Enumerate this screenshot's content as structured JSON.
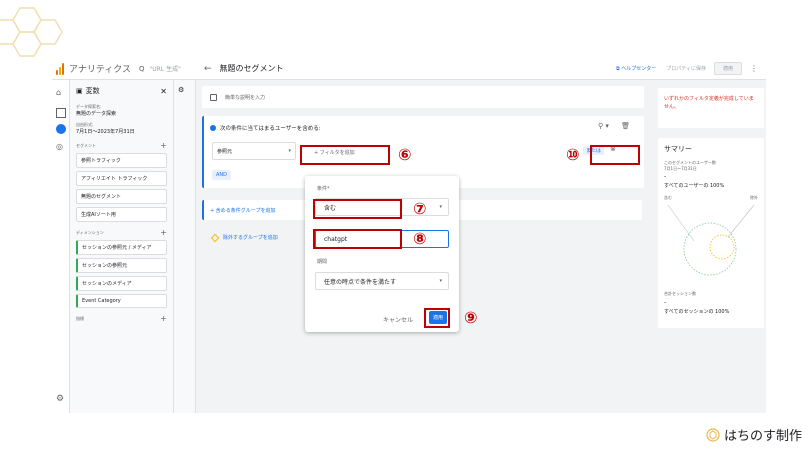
{
  "app": {
    "brand": "アナリティクス",
    "search_icon": "search-icon",
    "top_url": "\"URL 生成\""
  },
  "variables_panel": {
    "title": "変数",
    "data_source_label": "データ探索名:",
    "data_source_value": "無題のデータ探索",
    "date_label": "自由形式:",
    "date_value": "7月1日〜2023年7月31日",
    "segments_label": "セグメント",
    "segments": [
      "参照トラフィック",
      "アフィリエイト トラフィック",
      "無題のセグメント",
      "生成AIソート用"
    ],
    "dimensions_label": "ディメンション",
    "dimensions": [
      "セッションの参照元 / メディア",
      "セッションの参照元",
      "セッションのメディア",
      "Event Category"
    ],
    "metrics_label": "指標"
  },
  "editor": {
    "title": "無題のセグメント",
    "help": "ヘルプセンター",
    "save_to_property": "プロパティに保存",
    "apply": "適用",
    "description_placeholder": "簡単な説明を入力",
    "condition_title": "次の条件に当てはまるユーザーを含める:",
    "field": "参照元",
    "add_filter": "+ フィルタを追加",
    "or_label": "または",
    "and_label": "AND",
    "include_group": "+ 含める条件グループを追加",
    "exclude_group": "除外するグループを追加"
  },
  "popup": {
    "condition_label": "条件*",
    "condition_value": "含む",
    "value_input": "chatgpt",
    "period_label": "期間",
    "period_value": "任意の時点で条件を満たす",
    "cancel": "キャンセル",
    "apply": "適用"
  },
  "summary": {
    "warning": "いずれかのフィルタ定義が完成していません。",
    "title": "サマリー",
    "users_label": "このセグメントのユーザー数",
    "users_date": "7月1日〜7月31日",
    "users_value": "-",
    "all_users": "すべてのユーザーの 100%",
    "legend_left": "含む",
    "legend_right": "除外",
    "sessions_label": "合計セッション数",
    "sessions_value": "-",
    "all_sessions": "すべてのセッションの 100%"
  },
  "annotations": {
    "n6": "⑥",
    "n7": "⑦",
    "n8": "⑧",
    "n9": "⑨",
    "n10": "⑩"
  },
  "footer": {
    "brand": "はちのす制作"
  },
  "colors": {
    "accent": "#1a73e8",
    "annotation_red": "#c00000",
    "brand_gold": "#e8b84a"
  }
}
